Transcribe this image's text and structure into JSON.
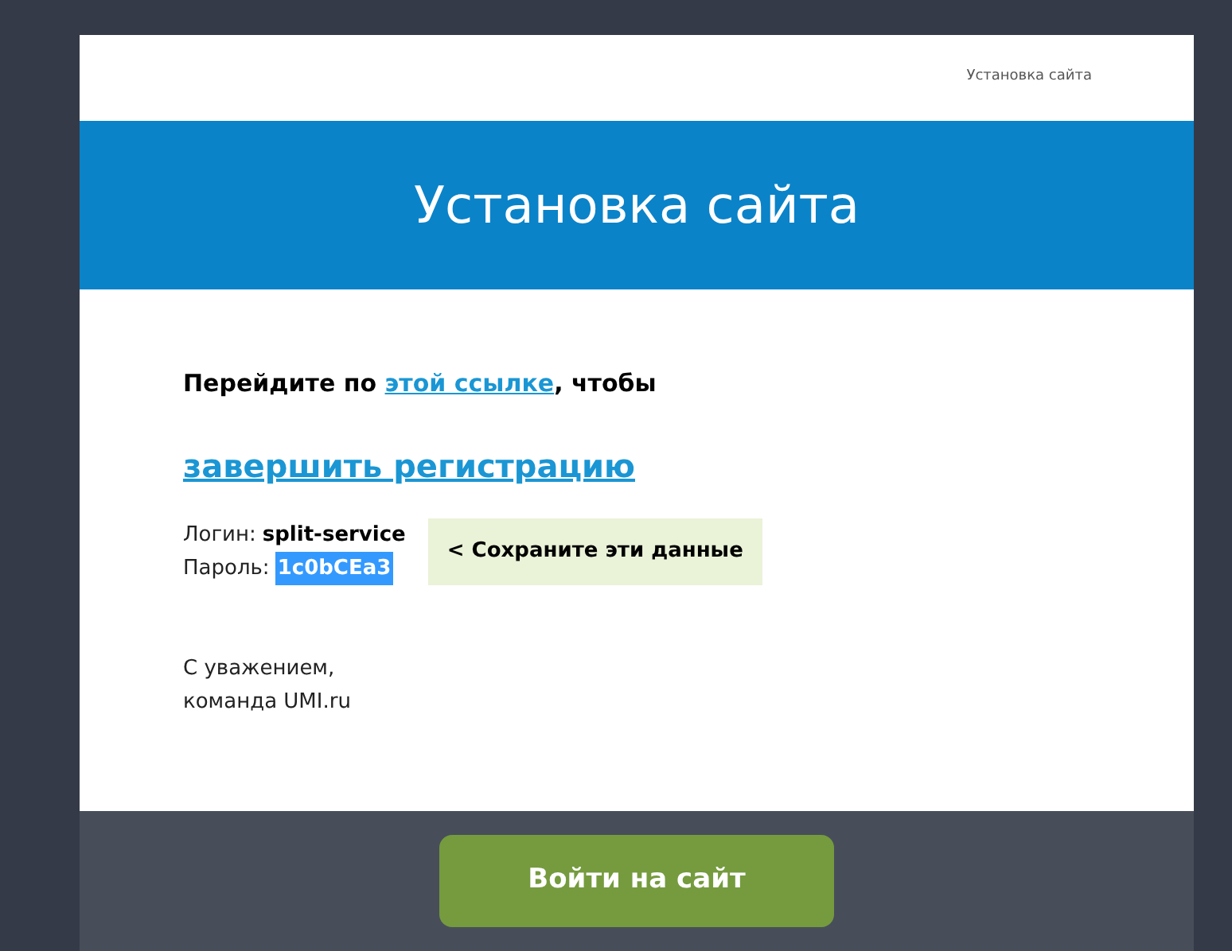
{
  "header": {
    "link": "Установка сайта"
  },
  "banner": {
    "title": "Установка сайта"
  },
  "intro": {
    "before": "Перейдите по ",
    "link": "этой ссылке",
    "after": ", чтобы"
  },
  "action_link": "завершить регистрацию",
  "credentials": [
    {
      "label": "Логин:",
      "value": "split-service",
      "selected": false
    },
    {
      "label": "Пароль:",
      "value": "1c0bCEa3",
      "selected": true
    }
  ],
  "note": "< Сохраните эти данные",
  "signature": [
    "С уважением,",
    "команда UMI.ru"
  ],
  "footer": {
    "button": "Войти на сайт"
  }
}
